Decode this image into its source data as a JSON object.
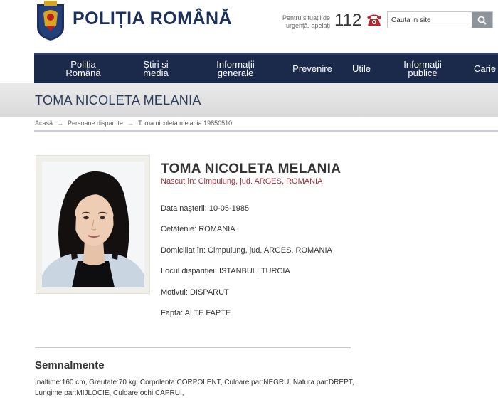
{
  "header": {
    "brand": "POLIȚIA ROMÂNĂ",
    "emergency_text": "Pentru situații de urgență, apelați",
    "emergency_number": "112",
    "search_placeholder": "Cauta in site"
  },
  "nav": {
    "items": [
      {
        "label": "Poliția Română"
      },
      {
        "label": "Știri și media"
      },
      {
        "label": "Informații generale"
      },
      {
        "label": "Prevenire"
      },
      {
        "label": "Utile"
      },
      {
        "label": "Informații publice"
      },
      {
        "label": "Carie"
      }
    ]
  },
  "page": {
    "title": "TOMA NICOLETA MELANIA"
  },
  "breadcrumb": {
    "items": [
      "Acasă",
      "Persoane disparute",
      "Toma nicoleta melania 19850510"
    ]
  },
  "profile": {
    "name": "TOMA NICOLETA MELANIA",
    "birthplace": "Nascut în: Cimpulung, jud. ARGES, ROMANIA",
    "facts": [
      {
        "label": "Data nașterii:",
        "value": "10-05-1985"
      },
      {
        "label": "Cetățenie:",
        "value": "ROMANIA"
      },
      {
        "label": "Domiciliat în:",
        "value": "Cimpulung, jud. ARGES, ROMANIA"
      },
      {
        "label": "Locul dispariției:",
        "value": "ISTANBUL, TURCIA"
      },
      {
        "label": "Motivul:",
        "value": "DISPARUT"
      },
      {
        "label": "Fapta:",
        "value": "ALTE FAPTE"
      }
    ]
  },
  "semnalmente": {
    "title": "Semnalmente",
    "text": "Inaltime:160 cm, Greutate:70 kg, Corpolenta:CORPOLENT, Culoare par:NEGRU, Natura par:DREPT, Lungime par:MIJLOCIE, Culoare ochi:CAPRUI,"
  },
  "colors": {
    "navy": "#1b2a4a",
    "brand": "#1d2f5c",
    "accent_red": "#a0303a"
  },
  "icons": {
    "logo": "romanian-police-crest-icon",
    "phone": "telephone-icon",
    "search": "search-icon"
  }
}
